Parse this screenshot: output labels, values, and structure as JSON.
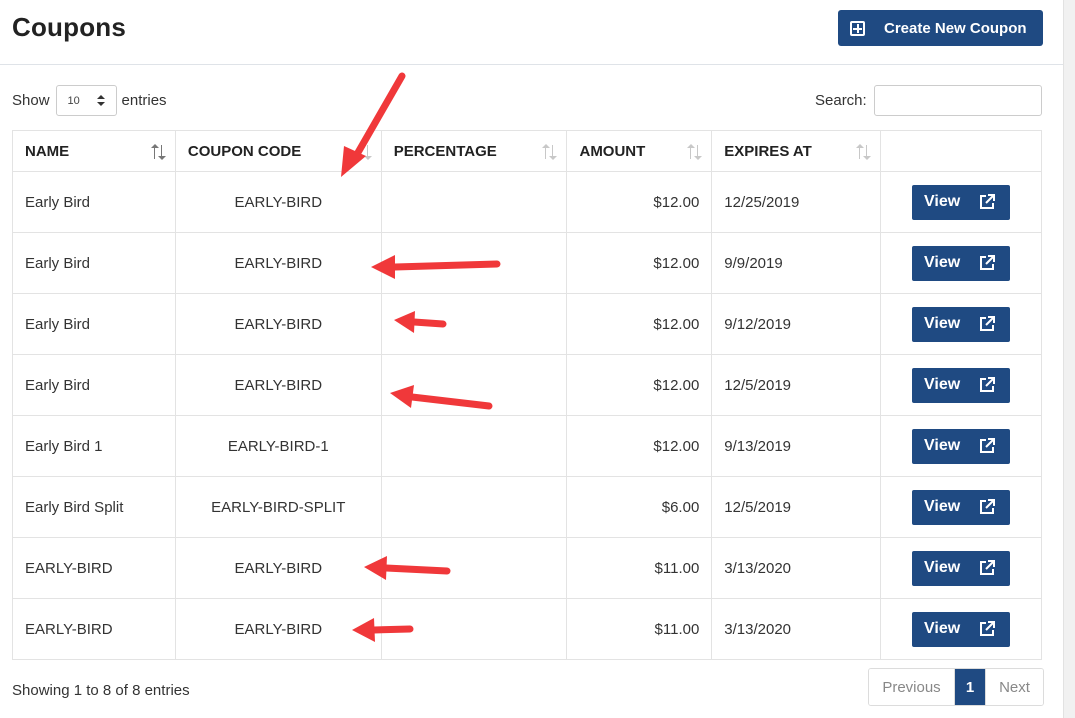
{
  "header": {
    "title": "Coupons",
    "create_button_label": "Create New Coupon"
  },
  "length_control": {
    "prefix": "Show",
    "value": "10",
    "suffix": "entries"
  },
  "search": {
    "label": "Search:",
    "value": ""
  },
  "table": {
    "columns": [
      "NAME",
      "COUPON CODE",
      "PERCENTAGE",
      "AMOUNT",
      "EXPIRES AT",
      ""
    ],
    "rows": [
      {
        "name": "Early Bird",
        "code": "EARLY-BIRD",
        "percentage": "",
        "amount": "$12.00",
        "expires": "12/25/2019",
        "action": "View"
      },
      {
        "name": "Early Bird",
        "code": "EARLY-BIRD",
        "percentage": "",
        "amount": "$12.00",
        "expires": "9/9/2019",
        "action": "View"
      },
      {
        "name": "Early Bird",
        "code": "EARLY-BIRD",
        "percentage": "",
        "amount": "$12.00",
        "expires": "9/12/2019",
        "action": "View"
      },
      {
        "name": "Early Bird",
        "code": "EARLY-BIRD",
        "percentage": "",
        "amount": "$12.00",
        "expires": "12/5/2019",
        "action": "View"
      },
      {
        "name": "Early Bird 1",
        "code": "EARLY-BIRD-1",
        "percentage": "",
        "amount": "$12.00",
        "expires": "9/13/2019",
        "action": "View"
      },
      {
        "name": "Early Bird Split",
        "code": "EARLY-BIRD-SPLIT",
        "percentage": "",
        "amount": "$6.00",
        "expires": "12/5/2019",
        "action": "View"
      },
      {
        "name": "EARLY-BIRD",
        "code": "EARLY-BIRD",
        "percentage": "",
        "amount": "$11.00",
        "expires": "3/13/2020",
        "action": "View"
      },
      {
        "name": "EARLY-BIRD",
        "code": "EARLY-BIRD",
        "percentage": "",
        "amount": "$11.00",
        "expires": "3/13/2020",
        "action": "View"
      }
    ]
  },
  "footer": {
    "info": "Showing 1 to 8 of 8 entries",
    "previous_label": "Previous",
    "current_page": "1",
    "next_label": "Next"
  },
  "colors": {
    "accent": "#1f4a82",
    "annotation_arrow": "#f0383a"
  },
  "icons": {
    "create": "plus-square-icon",
    "view": "external-link-icon",
    "sort": "sort-arrows-icon"
  }
}
